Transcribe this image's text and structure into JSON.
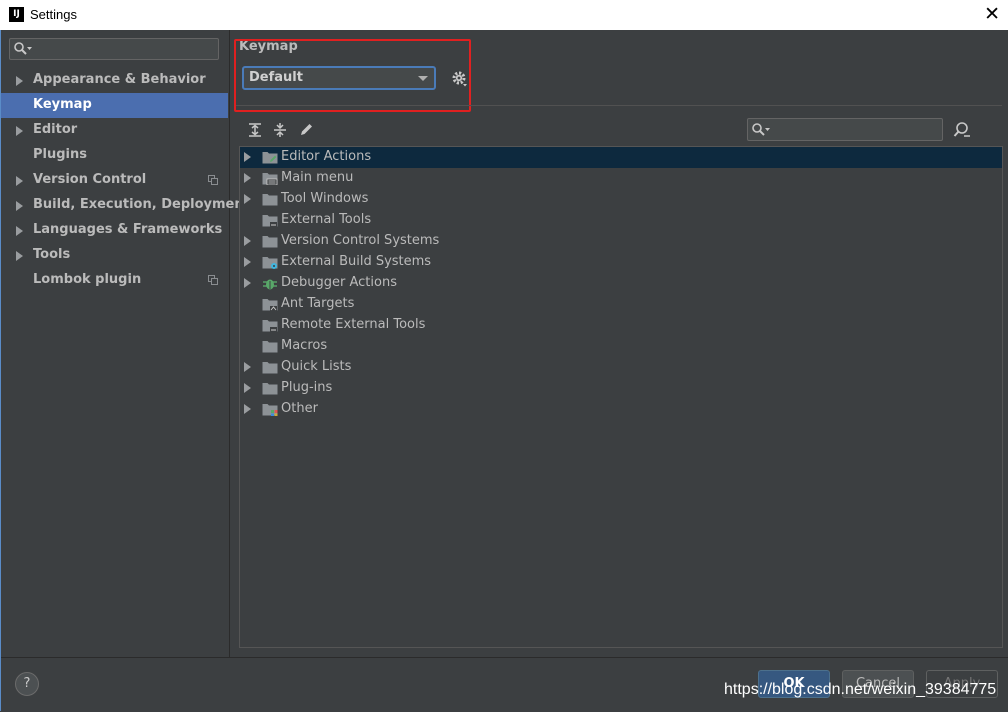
{
  "window": {
    "title": "Settings",
    "app_icon_text": "IJ"
  },
  "sidebar": {
    "search": {
      "value": "",
      "placeholder": ""
    },
    "items": [
      {
        "label": "Appearance & Behavior",
        "expandable": true,
        "selected": false,
        "project_icon": false
      },
      {
        "label": "Keymap",
        "expandable": false,
        "selected": true,
        "project_icon": false
      },
      {
        "label": "Editor",
        "expandable": true,
        "selected": false,
        "project_icon": false
      },
      {
        "label": "Plugins",
        "expandable": false,
        "selected": false,
        "project_icon": false
      },
      {
        "label": "Version Control",
        "expandable": true,
        "selected": false,
        "project_icon": true
      },
      {
        "label": "Build, Execution, Deployment",
        "expandable": true,
        "selected": false,
        "project_icon": false
      },
      {
        "label": "Languages & Frameworks",
        "expandable": true,
        "selected": false,
        "project_icon": false
      },
      {
        "label": "Tools",
        "expandable": true,
        "selected": false,
        "project_icon": false
      },
      {
        "label": "Lombok plugin",
        "expandable": false,
        "selected": false,
        "project_icon": true
      }
    ]
  },
  "keymap": {
    "title": "Keymap",
    "selected_scheme": "Default"
  },
  "tree_search": {
    "value": "",
    "placeholder": ""
  },
  "tree": [
    {
      "label": "Editor Actions",
      "expandable": true,
      "selected": true,
      "icon": "folder-editor-icon"
    },
    {
      "label": "Main menu",
      "expandable": true,
      "selected": false,
      "icon": "folder-menu-icon"
    },
    {
      "label": "Tool Windows",
      "expandable": true,
      "selected": false,
      "icon": "folder-icon"
    },
    {
      "label": "External Tools",
      "expandable": false,
      "selected": false,
      "icon": "folder-tools-icon"
    },
    {
      "label": "Version Control Systems",
      "expandable": true,
      "selected": false,
      "icon": "folder-icon"
    },
    {
      "label": "External Build Systems",
      "expandable": true,
      "selected": false,
      "icon": "folder-build-icon"
    },
    {
      "label": "Debugger Actions",
      "expandable": true,
      "selected": false,
      "icon": "debugger-bug-icon"
    },
    {
      "label": "Ant Targets",
      "expandable": false,
      "selected": false,
      "icon": "folder-ant-icon"
    },
    {
      "label": "Remote External Tools",
      "expandable": false,
      "selected": false,
      "icon": "folder-tools-icon"
    },
    {
      "label": "Macros",
      "expandable": false,
      "selected": false,
      "icon": "folder-icon"
    },
    {
      "label": "Quick Lists",
      "expandable": true,
      "selected": false,
      "icon": "folder-icon"
    },
    {
      "label": "Plug-ins",
      "expandable": true,
      "selected": false,
      "icon": "folder-icon"
    },
    {
      "label": "Other",
      "expandable": true,
      "selected": false,
      "icon": "folder-other-icon"
    }
  ],
  "footer": {
    "help_label": "?",
    "ok_label": "OK",
    "cancel_label": "Cancel",
    "apply_label": "Apply"
  },
  "watermark": "https://blog.csdn.net/weixin_39384775",
  "colors": {
    "background": "#3c3f41",
    "selection": "#4b6eaf",
    "tree_selection": "#0d293e",
    "highlight_box": "#e02020",
    "ok_button": "#365880"
  }
}
